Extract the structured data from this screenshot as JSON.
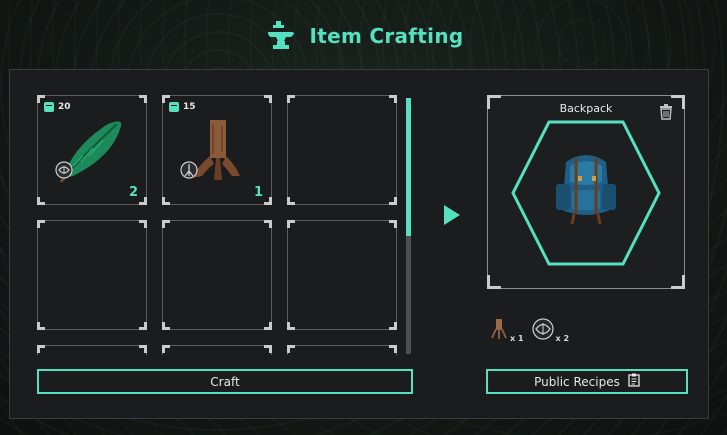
{
  "header": {
    "title": "Item Crafting",
    "icon": "anvil-icon"
  },
  "inventory": {
    "slots": [
      {
        "item": "leaf",
        "stock": "20",
        "quantity": "2"
      },
      {
        "item": "tree-root",
        "stock": "15",
        "quantity": "1"
      },
      {
        "item": "",
        "stock": "",
        "quantity": ""
      },
      {
        "item": "",
        "stock": "",
        "quantity": ""
      },
      {
        "item": "",
        "stock": "",
        "quantity": ""
      },
      {
        "item": "",
        "stock": "",
        "quantity": ""
      },
      {
        "item": "",
        "stock": "",
        "quantity": ""
      },
      {
        "item": "",
        "stock": "",
        "quantity": ""
      },
      {
        "item": "",
        "stock": "",
        "quantity": ""
      }
    ]
  },
  "result": {
    "title": "Backpack",
    "ingredients": [
      {
        "icon": "tree-root-icon",
        "qty": "x 1"
      },
      {
        "icon": "leaf-icon",
        "qty": "x 2"
      }
    ]
  },
  "buttons": {
    "craft": "Craft",
    "recipes": "Public Recipes"
  },
  "colors": {
    "accent": "#55e0c0",
    "panel": "#1a1c1d",
    "border": "#5a5e60"
  }
}
